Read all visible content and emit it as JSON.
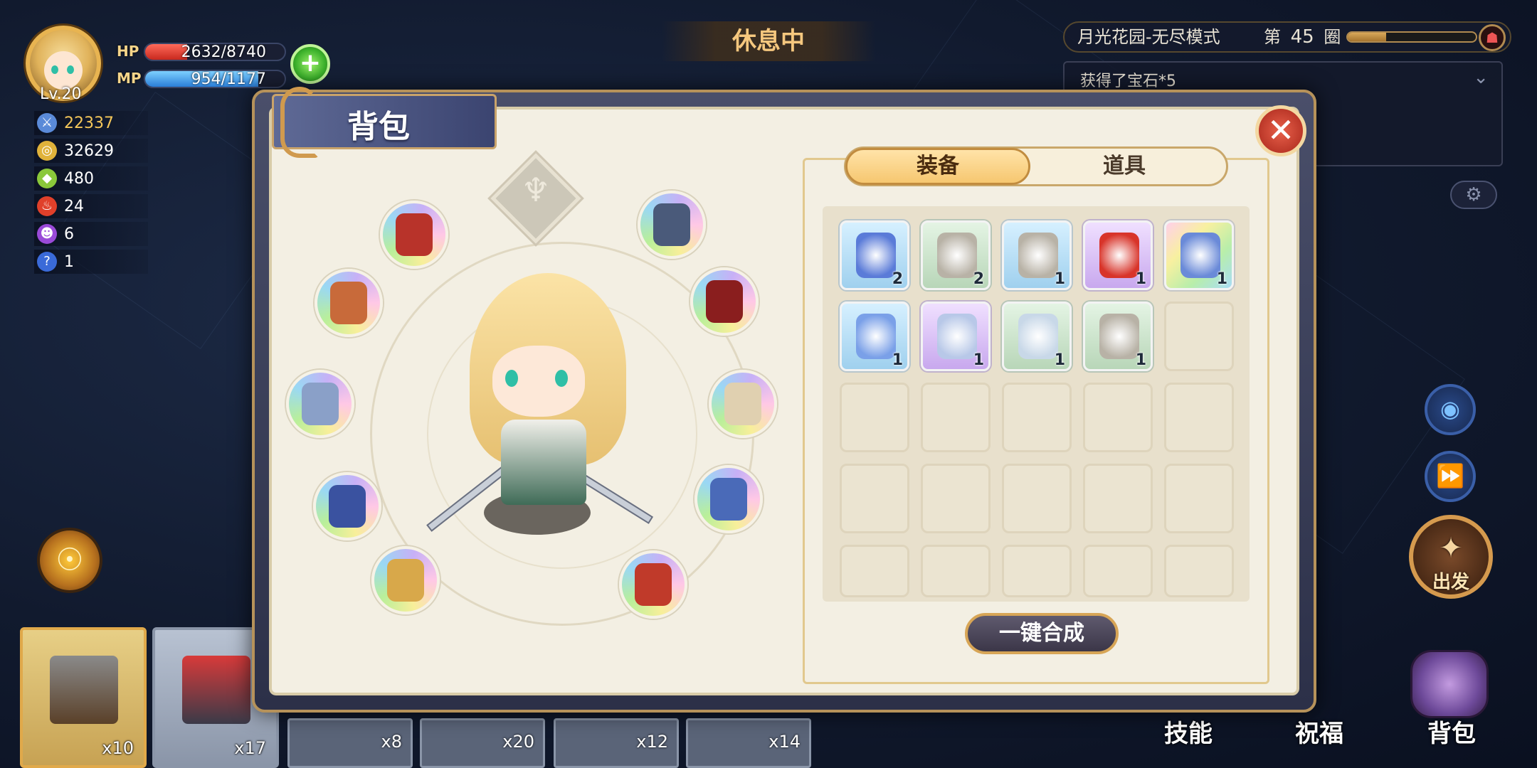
{
  "player": {
    "level": "Lv.20",
    "hp_label": "HP",
    "hp_text": "2632/8740",
    "hp_fraction": 0.301,
    "mp_label": "MP",
    "mp_text": "954/1177",
    "mp_fraction": 0.81,
    "plus_icon": "+"
  },
  "stats": [
    {
      "icon": "sword-icon",
      "value": "22337",
      "color": "#f5c75a"
    },
    {
      "icon": "coin-icon",
      "value": "32629",
      "color": "#ffffff"
    },
    {
      "icon": "gem-icon",
      "value": "480",
      "color": "#ffffff"
    },
    {
      "icon": "flame-demon-icon",
      "value": "24",
      "color": "#ffffff"
    },
    {
      "icon": "purple-demon-icon",
      "value": "6",
      "color": "#ffffff"
    },
    {
      "icon": "question-icon",
      "value": "1",
      "color": "#ffffff"
    }
  ],
  "status_banner": "休息中",
  "stage": {
    "name": "月光花园-无尽模式",
    "round_prefix": "第",
    "round": "45",
    "round_suffix": "圈",
    "progress": 0.3
  },
  "log": {
    "line1": "获得了宝石*5"
  },
  "bag": {
    "title": "背包",
    "close_icon": "✕",
    "tabs": [
      {
        "label": "装备",
        "active": true
      },
      {
        "label": "道具",
        "active": false
      }
    ],
    "synthesize_label": "一键合成",
    "crest_icon": "♆",
    "items": [
      {
        "name": "belt-icon",
        "rarity": "blue",
        "qty": "2",
        "color": "#5a7bd8"
      },
      {
        "name": "cloak-icon",
        "rarity": "green",
        "qty": "2",
        "color": "#b8b2a6"
      },
      {
        "name": "cloak-icon",
        "rarity": "blue",
        "qty": "1",
        "color": "#b8b2a6"
      },
      {
        "name": "amulet-icon",
        "rarity": "purple",
        "qty": "1",
        "color": "#d8342a"
      },
      {
        "name": "armor-icon",
        "rarity": "rainbow",
        "qty": "1",
        "color": "#6a8ad8"
      },
      {
        "name": "sword-item-icon",
        "rarity": "blue",
        "qty": "1",
        "color": "#7aa0e8"
      },
      {
        "name": "ring-item-icon",
        "rarity": "purple",
        "qty": "1",
        "color": "#b8c8e8"
      },
      {
        "name": "gauntlet-icon",
        "rarity": "green",
        "qty": "1",
        "color": "#c8d8e8"
      },
      {
        "name": "cloak-icon",
        "rarity": "green",
        "qty": "1",
        "color": "#b8b2a6"
      }
    ],
    "equip_slots": [
      {
        "name": "helmet-slot",
        "color": "#b8332a"
      },
      {
        "name": "ring-slot",
        "color": "#c86a3a"
      },
      {
        "name": "armor-slot",
        "color": "#8aa0c8"
      },
      {
        "name": "bracelet-slot",
        "color": "#3a52a0"
      },
      {
        "name": "weapon-slot",
        "color": "#d8a84a"
      },
      {
        "name": "necklace-slot",
        "color": "#4a5a7a"
      },
      {
        "name": "cape-slot",
        "color": "#8a1e1e"
      },
      {
        "name": "boots-slot",
        "color": "#e0d0b0"
      },
      {
        "name": "belt-slot",
        "color": "#4a6ab8"
      },
      {
        "name": "gloves-slot",
        "color": "#c03a2a"
      }
    ]
  },
  "side": {
    "gear_icon": "⚙",
    "eye_icon": "◉",
    "fast_forward_icon": "⏩",
    "depart_label": "出发",
    "depart_symbol": "✦",
    "orb_icon": "☉"
  },
  "bottom": {
    "cards": [
      {
        "name": "hammer-card",
        "count": "x10"
      },
      {
        "name": "forge-card",
        "count": "x17"
      }
    ],
    "small_cards": [
      "x8",
      "x20",
      "x12",
      "x14"
    ],
    "menu": {
      "skills": "技能",
      "blessing": "祝福",
      "bag": "背包"
    }
  }
}
